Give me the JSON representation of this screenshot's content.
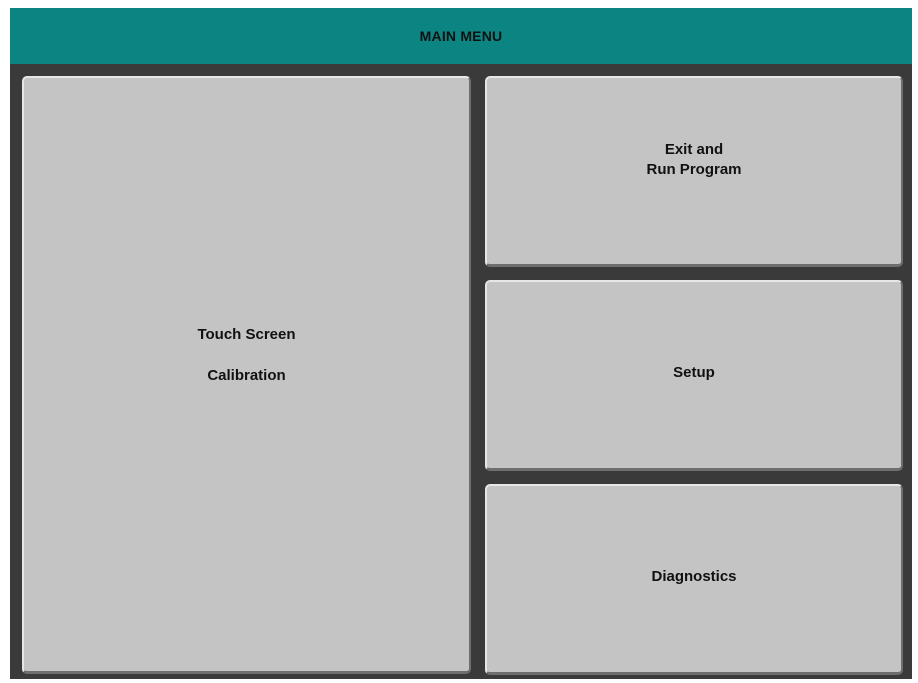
{
  "header": {
    "title": "MAIN MENU"
  },
  "buttons": {
    "calibration": {
      "line1": "Touch Screen",
      "line2": "Calibration"
    },
    "exit_run": {
      "line1": "Exit and",
      "line2": "Run Program"
    },
    "setup": {
      "label": "Setup"
    },
    "diagnostics": {
      "label": "Diagnostics"
    }
  },
  "colors": {
    "header": "#0b8482",
    "button_face": "#c4c4c4",
    "frame": "#3a3a3a"
  }
}
